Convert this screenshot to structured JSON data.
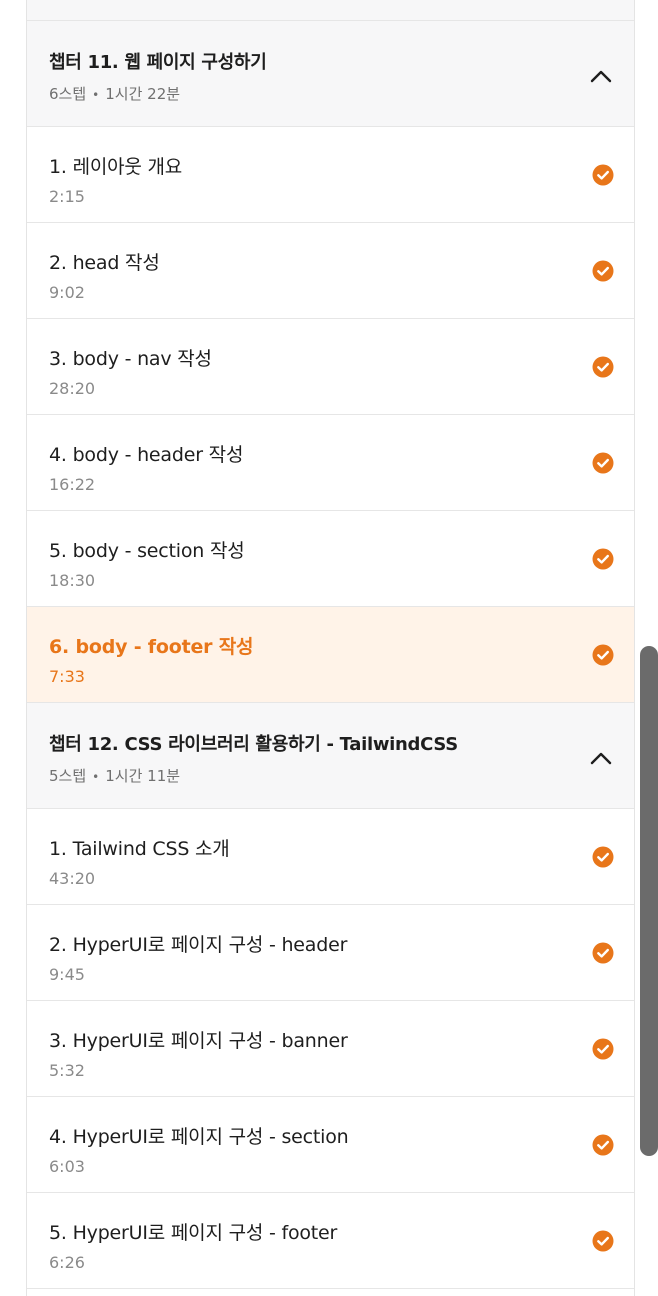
{
  "chapters": [
    {
      "title": "챕터 11. 웹 페이지 구성하기",
      "steps_count": "6스텝",
      "duration": "1시간 22분",
      "steps": [
        {
          "title": "1. 레이아웃 개요",
          "time": "2:15"
        },
        {
          "title": "2. head 작성",
          "time": "9:02"
        },
        {
          "title": "3. body - nav 작성",
          "time": "28:20"
        },
        {
          "title": "4. body - header 작성",
          "time": "16:22"
        },
        {
          "title": "5. body - section 작성",
          "time": "18:30"
        },
        {
          "title": "6. body - footer 작성",
          "time": "7:33"
        }
      ]
    },
    {
      "title": "챕터 12. CSS 라이브러리 활용하기 - TailwindCSS",
      "steps_count": "5스텝",
      "duration": "1시간 11분",
      "steps": [
        {
          "title": "1. Tailwind CSS 소개",
          "time": "43:20"
        },
        {
          "title": "2. HyperUI로 페이지 구성 - header",
          "time": "9:45"
        },
        {
          "title": "3. HyperUI로 페이지 구성 - banner",
          "time": "5:32"
        },
        {
          "title": "4. HyperUI로 페이지 구성 - section",
          "time": "6:03"
        },
        {
          "title": "5. HyperUI로 페이지 구성 - footer",
          "time": "6:26"
        }
      ]
    }
  ],
  "colors": {
    "accent": "#e8761a",
    "active_bg": "#fff3e8",
    "header_bg": "#f7f7f8"
  }
}
